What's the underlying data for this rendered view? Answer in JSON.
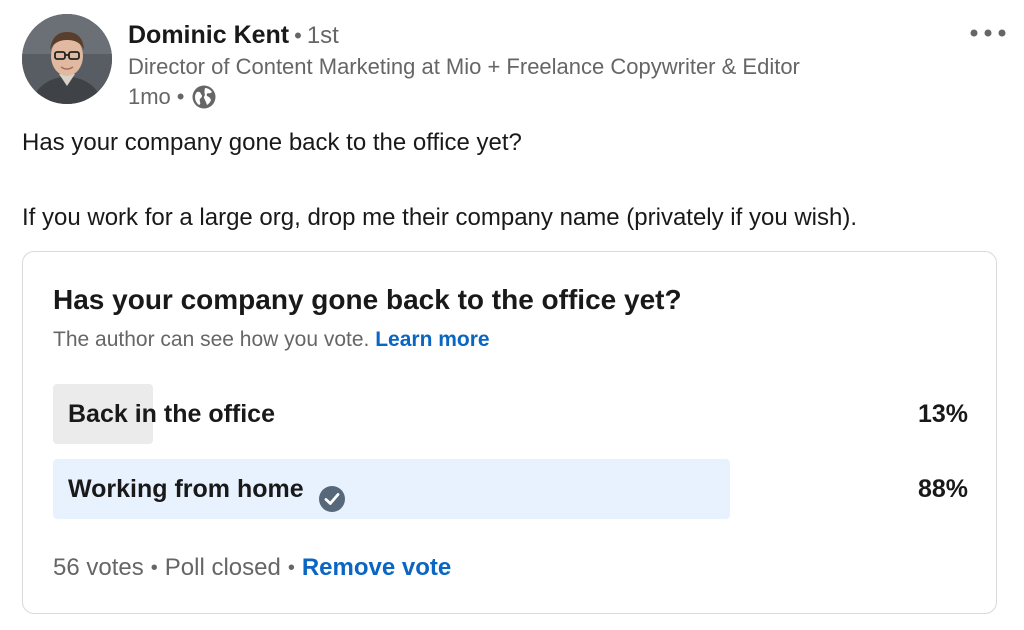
{
  "post": {
    "author": {
      "name": "Dominic Kent",
      "separator": "•",
      "degree": "1st",
      "headline": "Director of Content Marketing at Mio + Freelance Copywriter & Editor",
      "time": "1mo",
      "visibility_icon": "globe-icon"
    },
    "more_icon": "ellipsis-icon",
    "text": {
      "line1": "Has your company gone back to the office yet?",
      "line2": "If you work for a large org, drop me their company name (privately if you wish)."
    }
  },
  "poll": {
    "question": "Has your company gone back to the office yet?",
    "note": "The author can see how you vote.",
    "learn_more": "Learn more",
    "options": [
      {
        "label": "Back in the office",
        "percent_label": "13%",
        "percent": 13,
        "selected": false
      },
      {
        "label": "Working from home",
        "percent_label": "88%",
        "percent": 88,
        "selected": true,
        "selected_icon": "check-circle-icon"
      }
    ],
    "footer": {
      "votes": "56 votes",
      "status": "Poll closed",
      "remove_vote": "Remove vote"
    }
  },
  "colors": {
    "link": "#0a66c2",
    "muted_text": "#666666",
    "primary_text": "#191919",
    "bar_unselected": "#ebebeb",
    "bar_selected": "#e8f2ff",
    "card_border": "#d9d9d9"
  }
}
